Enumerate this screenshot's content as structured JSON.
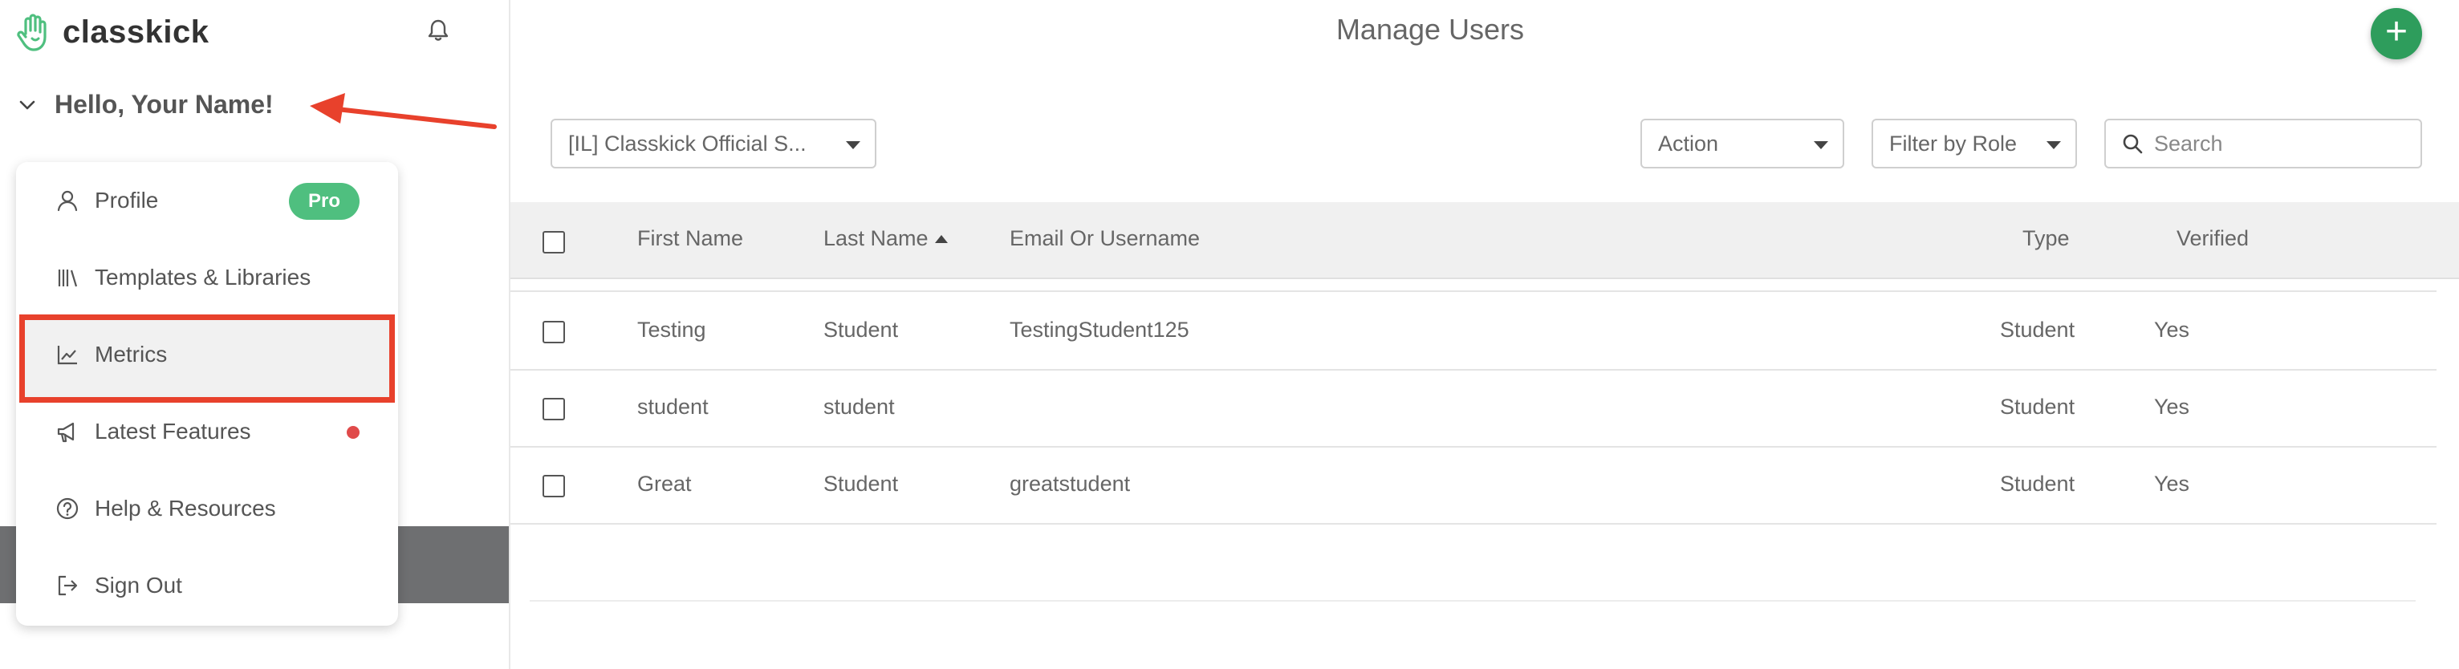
{
  "brand": {
    "name": "classkick",
    "logo_icon": "hand-logo-icon",
    "color": "#4fbf7f"
  },
  "sidebar": {
    "greeting": "Hello, Your Name!",
    "menu": [
      {
        "label": "Profile",
        "icon": "user-icon",
        "badge": "Pro"
      },
      {
        "label": "Templates & Libraries",
        "icon": "library-icon"
      },
      {
        "label": "Metrics",
        "icon": "chart-line-icon"
      },
      {
        "label": "Latest Features",
        "icon": "megaphone-icon",
        "has_dot": true
      },
      {
        "label": "Help & Resources",
        "icon": "help-circle-icon"
      },
      {
        "label": "Sign Out",
        "icon": "sign-out-icon"
      }
    ]
  },
  "header": {
    "title": "Manage Users",
    "add_label": "+"
  },
  "filters": {
    "school": "[IL] Classkick Official S...",
    "action": "Action",
    "role": "Filter by Role",
    "search_placeholder": "Search"
  },
  "table": {
    "columns": [
      "First Name",
      "Last Name",
      "Email Or Username",
      "Type",
      "Verified"
    ],
    "sorted_column": "Last Name",
    "rows": [
      {
        "first": "Testing",
        "last": "Student",
        "email": "TestingStudent125",
        "type": "Student",
        "verified": "Yes"
      },
      {
        "first": "student",
        "last": "student",
        "email": "",
        "type": "Student",
        "verified": "Yes"
      },
      {
        "first": "Great",
        "last": "Student",
        "email": "greatstudent",
        "type": "Student",
        "verified": "Yes"
      }
    ]
  },
  "colors": {
    "accent_green": "#2e9d5c",
    "pro_green": "#4fbf7f",
    "highlight_red": "#e8412c"
  }
}
